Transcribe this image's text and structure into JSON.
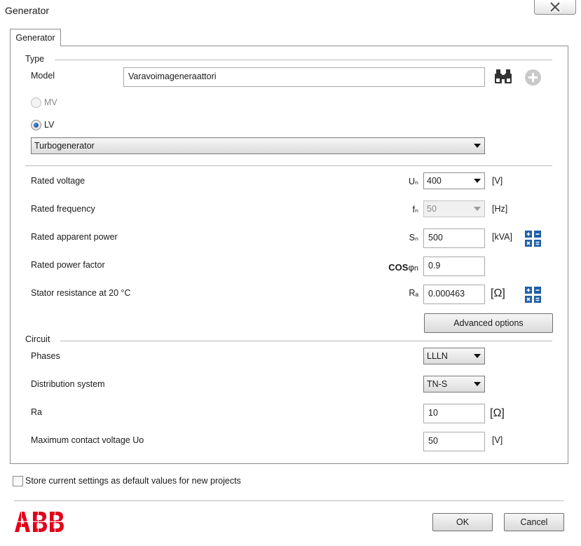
{
  "window": {
    "title": "Generator"
  },
  "tab": {
    "label": "Generator"
  },
  "type_section": {
    "title": "Type",
    "model_label": "Model",
    "model_value": "Varavoimageneraattori",
    "mv_label": "MV",
    "lv_label": "LV",
    "generator_type": "Turbogenerator"
  },
  "rated": {
    "voltage": {
      "label": "Rated voltage",
      "symbol": "Uₙ",
      "value": "400",
      "unit": "[V]"
    },
    "frequency": {
      "label": "Rated frequency",
      "symbol": "fₙ",
      "value": "50",
      "unit": "[Hz]"
    },
    "apparent_power": {
      "label": "Rated apparent power",
      "symbol": "Sₙ",
      "value": "500",
      "unit": "[kVA]"
    },
    "power_factor": {
      "label": "Rated power factor",
      "symbol_main": "COS",
      "symbol_phi": "φ",
      "symbol_sub": "n",
      "value": "0.9"
    },
    "stator_resistance": {
      "label": "Stator resistance at 20 °C",
      "symbol": "Rₐ",
      "value": "0.000463",
      "unit": "[Ω]"
    }
  },
  "advanced_options_label": "Advanced options",
  "circuit": {
    "title": "Circuit",
    "phases": {
      "label": "Phases",
      "value": "LLLN"
    },
    "distribution": {
      "label": "Distribution system",
      "value": "TN-S"
    },
    "ra": {
      "label": "Ra",
      "value": "10",
      "unit": "[Ω]"
    },
    "contact_voltage": {
      "label": "Maximum contact voltage Uo",
      "value": "50",
      "unit": "[V]"
    }
  },
  "store_defaults_label": "Store current settings as default values for new projects",
  "footer": {
    "ok_label": "OK",
    "cancel_label": "Cancel"
  },
  "colors": {
    "abb_red": "#e2001a",
    "icon_blue": "#1f5fa8"
  }
}
